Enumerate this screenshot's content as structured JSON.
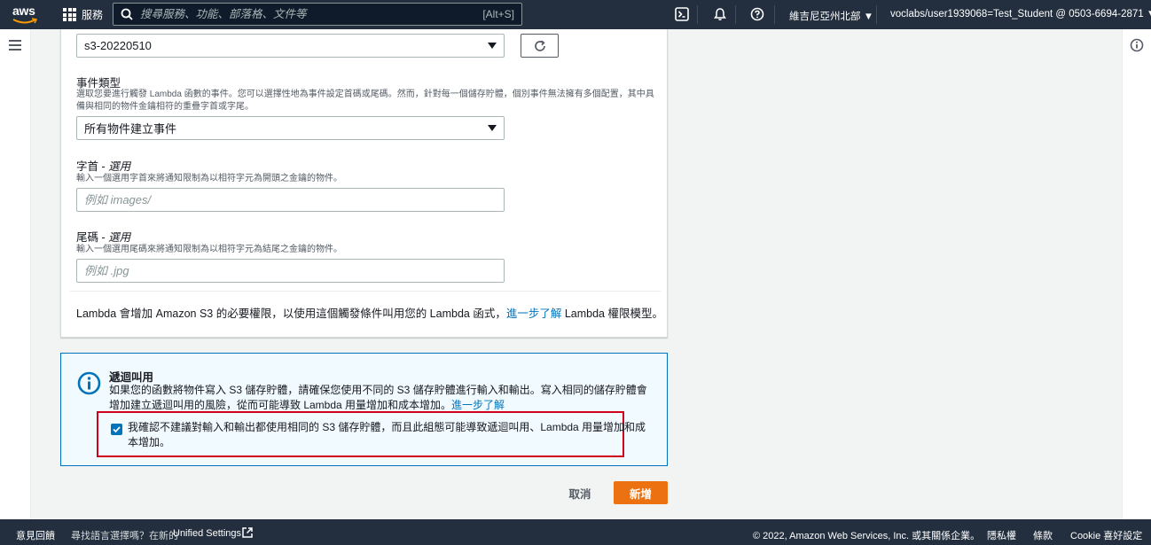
{
  "topnav": {
    "logo_text": "aws",
    "services_label": "服務",
    "search_placeholder": "搜尋服務、功能、部落格、文件等",
    "search_shortcut": "[Alt+S]",
    "region": "維吉尼亞州北部 ▼",
    "account": "voclabs/user1939068=Test_Student @ 0503-6694-2871 ▼"
  },
  "form": {
    "bucket_select_value": "s3-20220510",
    "event_type": {
      "label": "事件類型",
      "description": "選取您要進行觸發 Lambda 函數的事件。您可以選擇性地為事件設定首碼或尾碼。然而，針對每一個儲存貯體，個別事件無法擁有多個配置，其中具備與相同的物件金鑰相符的重疊字首或字尾。",
      "value": "所有物件建立事件"
    },
    "prefix": {
      "label": "字首 - ",
      "label_optional": "選用",
      "description": "輸入一個選用字首來將通知限制為以相符字元為開頭之金鑰的物件。",
      "placeholder": "例如 images/"
    },
    "suffix": {
      "label": "尾碼 - ",
      "label_optional": "選用",
      "description": "輸入一個選用尾碼來將通知限制為以相符字元為結尾之金鑰的物件。",
      "placeholder": "例如 .jpg"
    },
    "permission_text_before": "Lambda 會增加 Amazon S3 的必要權限，以使用這個觸發條件叫用您的 Lambda 函式，",
    "permission_link": "進一步了解",
    "permission_text_after": " Lambda 權限模型。"
  },
  "alert": {
    "title": "遞迴叫用",
    "body": "如果您的函數將物件寫入 S3 儲存貯體，請確保您使用不同的 S3 儲存貯體進行輸入和輸出。寫入相同的儲存貯體會增加建立遞迴叫用的風險，從而可能導致 Lambda 用量增加和成本增加。",
    "link": "進一步了解",
    "confirm_text": "我確認不建議對輸入和輸出都使用相同的 S3 儲存貯體，而且此組態可能導致遞迴叫用、Lambda 用量增加和成本增加。"
  },
  "actions": {
    "cancel": "取消",
    "submit": "新增"
  },
  "footer": {
    "feedback": "意見回饋",
    "language_prompt": "尋找語言選擇嗎？在新的",
    "unified_settings": "Unified Settings",
    "copyright": "© 2022, Amazon Web Services, Inc. 或其關係企業。",
    "privacy": "隱私權",
    "terms": "條款",
    "cookie": "Cookie 喜好設定"
  },
  "colors": {
    "nav_bg": "#232f3e",
    "link": "#0073bb",
    "primary_button": "#ec7211",
    "highlight_border": "#d0021b",
    "alert_bg": "#f1faff"
  }
}
